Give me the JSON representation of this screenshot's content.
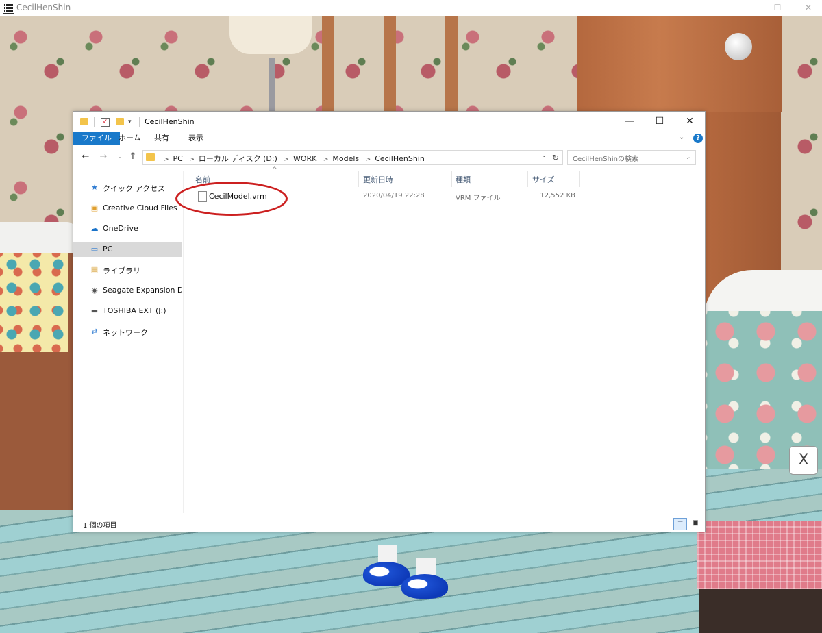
{
  "app": {
    "title": "CecilHenShin",
    "minimize": "—",
    "maximize": "☐",
    "close": "✕"
  },
  "explorer": {
    "title": "CecilHenShin",
    "quick_access_toolbar": [
      "folder-icon",
      "properties-icon",
      "new-folder-icon",
      "customize-icon"
    ],
    "window_controls": {
      "minimize": "—",
      "maximize": "☐",
      "close": "✕"
    },
    "ribbon": {
      "tabs": [
        "ファイル",
        "ホーム",
        "共有",
        "表示"
      ],
      "expand": "⌄",
      "help": "?"
    },
    "nav": {
      "back": "←",
      "forward": "→",
      "recent": "⌄",
      "up": "↑"
    },
    "address": {
      "crumbs": [
        "PC",
        "ローカル ディスク (D:)",
        "WORK",
        "Models",
        "CecilHenShin"
      ],
      "dropdown": "⌄",
      "refresh": "↻"
    },
    "search": {
      "placeholder": "CecilHenShinの検索",
      "icon": "⌕"
    },
    "navpane": [
      {
        "label": "クイック アクセス",
        "icon": "★"
      },
      {
        "label": "Creative Cloud Files",
        "icon": "▣"
      },
      {
        "label": "OneDrive",
        "icon": "☁"
      },
      {
        "label": "PC",
        "icon": "▭"
      },
      {
        "label": "ライブラリ",
        "icon": "▤"
      },
      {
        "label": "Seagate Expansion Drive",
        "icon": "◉"
      },
      {
        "label": "TOSHIBA EXT (J:)",
        "icon": "▬"
      },
      {
        "label": "ネットワーク",
        "icon": "⇄"
      }
    ],
    "columns": [
      "名前",
      "更新日時",
      "種類",
      "サイズ"
    ],
    "sort_caret": "^",
    "files": [
      {
        "name": "CecilModel.vrm",
        "modified": "2020/04/19 22:28",
        "type": "VRM ファイル",
        "size": "12,552 KB"
      }
    ],
    "status": "1 個の項目",
    "views": {
      "details": "☰",
      "large_icons": "▣"
    }
  },
  "scene": {
    "close_button": "X"
  },
  "colors": {
    "accent": "#1979ca",
    "highlight_circle": "#cc2020",
    "selected_nav": "#d9d9d9"
  }
}
